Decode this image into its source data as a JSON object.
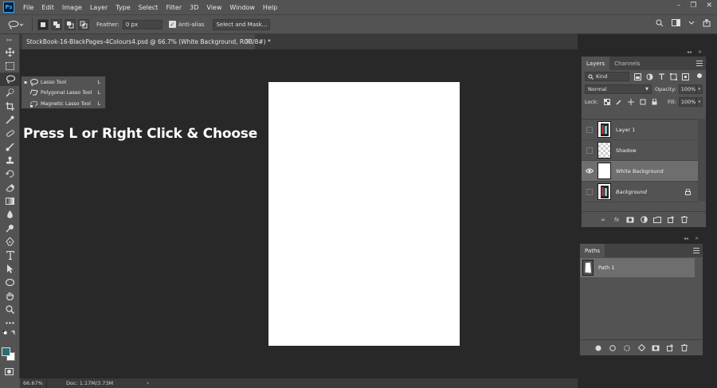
{
  "menubar": {
    "logo": "Ps",
    "items": [
      "File",
      "Edit",
      "Image",
      "Layer",
      "Type",
      "Select",
      "Filter",
      "3D",
      "View",
      "Window",
      "Help"
    ]
  },
  "options": {
    "feather_label": "Feather:",
    "feather_value": "0 px",
    "antialias_label": "Anti-alias",
    "select_mask_label": "Select and Mask..."
  },
  "document_tab": {
    "title": "StockBook-16-BlackPages-4Colours4.psd @ 66.7% (White Background, RGB/8#) *",
    "close": "×"
  },
  "tool_flyout": {
    "items": [
      {
        "label": "Lasso Tool",
        "shortcut": "L",
        "selected": true,
        "icon": "lasso-icon"
      },
      {
        "label": "Polygonal Lasso Tool",
        "shortcut": "L",
        "selected": false,
        "icon": "polygonal-lasso-icon"
      },
      {
        "label": "Magnetic Lasso Tool",
        "shortcut": "L",
        "selected": false,
        "icon": "magnetic-lasso-icon"
      }
    ],
    "marker": "▪"
  },
  "overlay": {
    "caption": "Press L or Right Click & Choose"
  },
  "status": {
    "zoom": "66.67%",
    "doc": "Doc: 1.17M/3.73M",
    "arrow": "›"
  },
  "layers_panel": {
    "tabs": [
      "Layers",
      "Channels"
    ],
    "kind_label": "Kind",
    "blend_mode": "Normal",
    "opacity_label": "Opacity:",
    "opacity_value": "100%",
    "lock_label": "Lock:",
    "fill_label": "Fill:",
    "fill_value": "100%",
    "layers": [
      {
        "name": "Layer 1",
        "visible": false,
        "selected": false,
        "thumb": "book",
        "italic": false,
        "locked": false
      },
      {
        "name": "Shadow",
        "visible": false,
        "selected": false,
        "thumb": "checker",
        "italic": false,
        "locked": false
      },
      {
        "name": "White Background",
        "visible": true,
        "selected": true,
        "thumb": "white",
        "italic": false,
        "locked": false
      },
      {
        "name": "Background",
        "visible": false,
        "selected": false,
        "thumb": "book",
        "italic": true,
        "locked": true
      }
    ]
  },
  "paths_panel": {
    "tab": "Paths",
    "paths": [
      {
        "name": "Path 1"
      }
    ]
  },
  "colors": {
    "foreground": "#2e6c72",
    "background": "#ffffff",
    "ui_panel": "#535353",
    "canvas_bg": "#282828"
  }
}
